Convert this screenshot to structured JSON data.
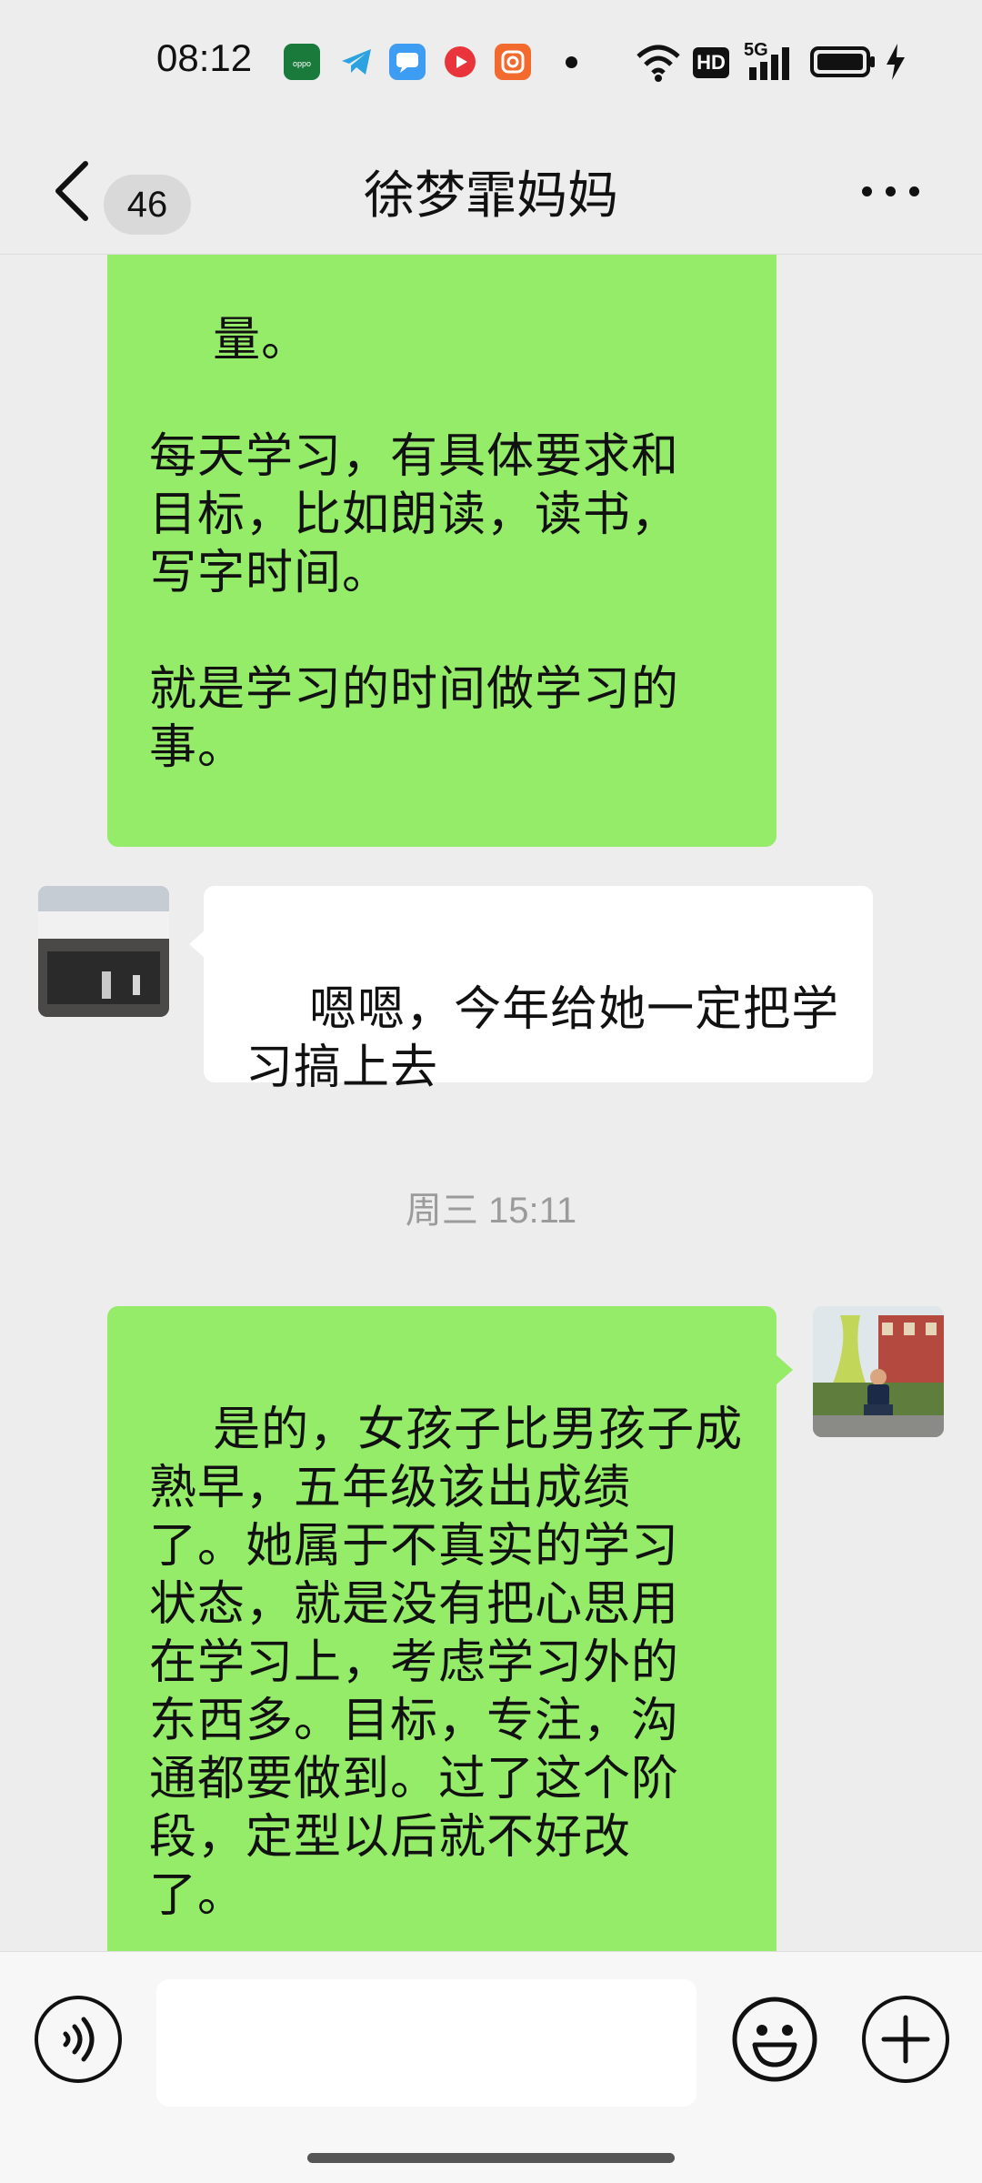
{
  "status_bar": {
    "time": "08:12",
    "app_icons": [
      "oppo-store-icon",
      "telegram-icon",
      "messenger-icon",
      "video-app-icon",
      "camera-app-icon"
    ],
    "network": "5G",
    "hd_label": "HD",
    "icons": [
      "wifi-icon",
      "hd-icon",
      "signal-icon",
      "battery-icon",
      "charging-icon"
    ]
  },
  "nav": {
    "unread_count": "46",
    "title": "徐梦霏妈妈"
  },
  "messages": [
    {
      "sender": "me",
      "text": "量。\n\n每天学习，有具体要求和\n目标，比如朗读，读书，\n写字时间。\n\n就是学习的时间做学习的\n事。"
    },
    {
      "sender": "other",
      "text": "嗯嗯，今年给她一定把学\n习搞上去"
    },
    {
      "sender": "timestamp",
      "text": "周三 15:11"
    },
    {
      "sender": "me",
      "text": "是的，女孩子比男孩子成\n熟早，五年级该出成绩\n了。她属于不真实的学习\n状态，就是没有把心思用\n在学习上，考虑学习外的\n东西多。目标，专注，沟\n通都要做到。过了这个阶\n段，定型以后就不好改\n了。"
    }
  ],
  "input_bar": {
    "placeholder": "",
    "icons": [
      "voice-icon",
      "emoji-icon",
      "plus-icon"
    ]
  },
  "colors": {
    "background": "#ededed",
    "my_bubble": "#95ec69",
    "their_bubble": "#ffffff",
    "timestamp": "#9b9b9b"
  }
}
